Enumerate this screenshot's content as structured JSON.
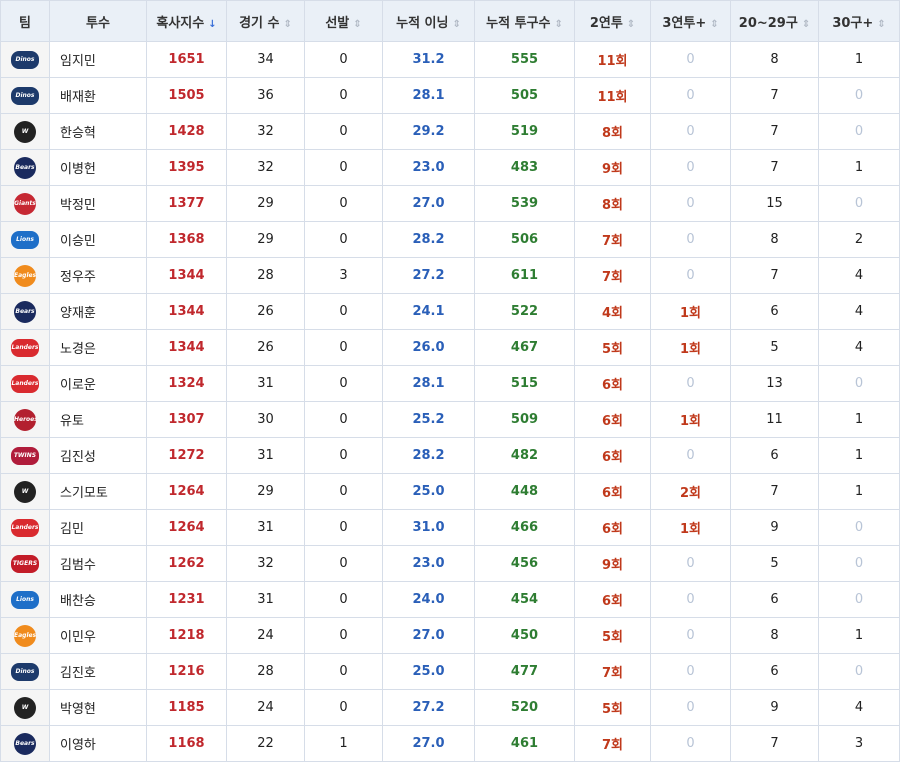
{
  "headers": [
    {
      "label": "팀",
      "sort": false,
      "active": false
    },
    {
      "label": "투수",
      "sort": false,
      "active": false
    },
    {
      "label": "혹사지수",
      "sort": true,
      "active": true,
      "arrow": "↓"
    },
    {
      "label": "경기 수",
      "sort": true,
      "active": false,
      "arrow": "⇕"
    },
    {
      "label": "선발",
      "sort": true,
      "active": false,
      "arrow": "⇕"
    },
    {
      "label": "누적 이닝",
      "sort": true,
      "active": false,
      "arrow": "⇕"
    },
    {
      "label": "누적 투구수",
      "sort": true,
      "active": false,
      "arrow": "⇕"
    },
    {
      "label": "2연투",
      "sort": true,
      "active": false,
      "arrow": "⇕"
    },
    {
      "label": "3연투+",
      "sort": true,
      "active": false,
      "arrow": "⇕"
    },
    {
      "label": "20~29구",
      "sort": true,
      "active": false,
      "arrow": "⇕"
    },
    {
      "label": "30구+",
      "sort": true,
      "active": false,
      "arrow": "⇕"
    }
  ],
  "teams": {
    "dinos": {
      "text": "Dinos",
      "bg": "#1d3a6b",
      "round": false
    },
    "wyverns": {
      "text": "W",
      "bg": "#222222",
      "round": true
    },
    "bears": {
      "text": "Bears",
      "bg": "#1a2a5e",
      "round": true
    },
    "giants": {
      "text": "Giants",
      "bg": "#c62833",
      "round": true
    },
    "lions": {
      "text": "Lions",
      "bg": "#1f6fc8",
      "round": false
    },
    "eagles": {
      "text": "Eagles",
      "bg": "#f08b1d",
      "round": true
    },
    "landers": {
      "text": "Landers",
      "bg": "#d92a2f",
      "round": false
    },
    "heroes": {
      "text": "Heroes",
      "bg": "#b3202f",
      "round": true
    },
    "twins": {
      "text": "TWINS",
      "bg": "#b01c3b",
      "round": false
    },
    "tigers": {
      "text": "TIGERS",
      "bg": "#c31c28",
      "round": false
    }
  },
  "rows": [
    {
      "team": "dinos",
      "name": "임지민",
      "index": "1651",
      "games": "34",
      "start": "0",
      "innings": "31.2",
      "pitches": "555",
      "two": "11회",
      "three": "0",
      "mid": "8",
      "high": "1"
    },
    {
      "team": "dinos",
      "name": "배재환",
      "index": "1505",
      "games": "36",
      "start": "0",
      "innings": "28.1",
      "pitches": "505",
      "two": "11회",
      "three": "0",
      "mid": "7",
      "high": "0"
    },
    {
      "team": "wyverns",
      "name": "한승혁",
      "index": "1428",
      "games": "32",
      "start": "0",
      "innings": "29.2",
      "pitches": "519",
      "two": "8회",
      "three": "0",
      "mid": "7",
      "high": "0"
    },
    {
      "team": "bears",
      "name": "이병헌",
      "index": "1395",
      "games": "32",
      "start": "0",
      "innings": "23.0",
      "pitches": "483",
      "two": "9회",
      "three": "0",
      "mid": "7",
      "high": "1"
    },
    {
      "team": "giants",
      "name": "박정민",
      "index": "1377",
      "games": "29",
      "start": "0",
      "innings": "27.0",
      "pitches": "539",
      "two": "8회",
      "three": "0",
      "mid": "15",
      "high": "0"
    },
    {
      "team": "lions",
      "name": "이승민",
      "index": "1368",
      "games": "29",
      "start": "0",
      "innings": "28.2",
      "pitches": "506",
      "two": "7회",
      "three": "0",
      "mid": "8",
      "high": "2"
    },
    {
      "team": "eagles",
      "name": "정우주",
      "index": "1344",
      "games": "28",
      "start": "3",
      "innings": "27.2",
      "pitches": "611",
      "two": "7회",
      "three": "0",
      "mid": "7",
      "high": "4"
    },
    {
      "team": "bears",
      "name": "양재훈",
      "index": "1344",
      "games": "26",
      "start": "0",
      "innings": "24.1",
      "pitches": "522",
      "two": "4회",
      "three": "1회",
      "mid": "6",
      "high": "4"
    },
    {
      "team": "landers",
      "name": "노경은",
      "index": "1344",
      "games": "26",
      "start": "0",
      "innings": "26.0",
      "pitches": "467",
      "two": "5회",
      "three": "1회",
      "mid": "5",
      "high": "4"
    },
    {
      "team": "landers",
      "name": "이로운",
      "index": "1324",
      "games": "31",
      "start": "0",
      "innings": "28.1",
      "pitches": "515",
      "two": "6회",
      "three": "0",
      "mid": "13",
      "high": "0"
    },
    {
      "team": "heroes",
      "name": "유토",
      "index": "1307",
      "games": "30",
      "start": "0",
      "innings": "25.2",
      "pitches": "509",
      "two": "6회",
      "three": "1회",
      "mid": "11",
      "high": "1"
    },
    {
      "team": "twins",
      "name": "김진성",
      "index": "1272",
      "games": "31",
      "start": "0",
      "innings": "28.2",
      "pitches": "482",
      "two": "6회",
      "three": "0",
      "mid": "6",
      "high": "1"
    },
    {
      "team": "wyverns",
      "name": "스기모토",
      "index": "1264",
      "games": "29",
      "start": "0",
      "innings": "25.0",
      "pitches": "448",
      "two": "6회",
      "three": "2회",
      "mid": "7",
      "high": "1"
    },
    {
      "team": "landers",
      "name": "김민",
      "index": "1264",
      "games": "31",
      "start": "0",
      "innings": "31.0",
      "pitches": "466",
      "two": "6회",
      "three": "1회",
      "mid": "9",
      "high": "0"
    },
    {
      "team": "tigers",
      "name": "김범수",
      "index": "1262",
      "games": "32",
      "start": "0",
      "innings": "23.0",
      "pitches": "456",
      "two": "9회",
      "three": "0",
      "mid": "5",
      "high": "0"
    },
    {
      "team": "lions",
      "name": "배찬승",
      "index": "1231",
      "games": "31",
      "start": "0",
      "innings": "24.0",
      "pitches": "454",
      "two": "6회",
      "three": "0",
      "mid": "6",
      "high": "0"
    },
    {
      "team": "eagles",
      "name": "이민우",
      "index": "1218",
      "games": "24",
      "start": "0",
      "innings": "27.0",
      "pitches": "450",
      "two": "5회",
      "three": "0",
      "mid": "8",
      "high": "1"
    },
    {
      "team": "dinos",
      "name": "김진호",
      "index": "1216",
      "games": "28",
      "start": "0",
      "innings": "25.0",
      "pitches": "477",
      "two": "7회",
      "three": "0",
      "mid": "6",
      "high": "0"
    },
    {
      "team": "wyverns",
      "name": "박영현",
      "index": "1185",
      "games": "24",
      "start": "0",
      "innings": "27.2",
      "pitches": "520",
      "two": "5회",
      "three": "0",
      "mid": "9",
      "high": "4"
    },
    {
      "team": "bears",
      "name": "이영하",
      "index": "1168",
      "games": "22",
      "start": "1",
      "innings": "27.0",
      "pitches": "461",
      "two": "7회",
      "three": "0",
      "mid": "7",
      "high": "3"
    }
  ]
}
